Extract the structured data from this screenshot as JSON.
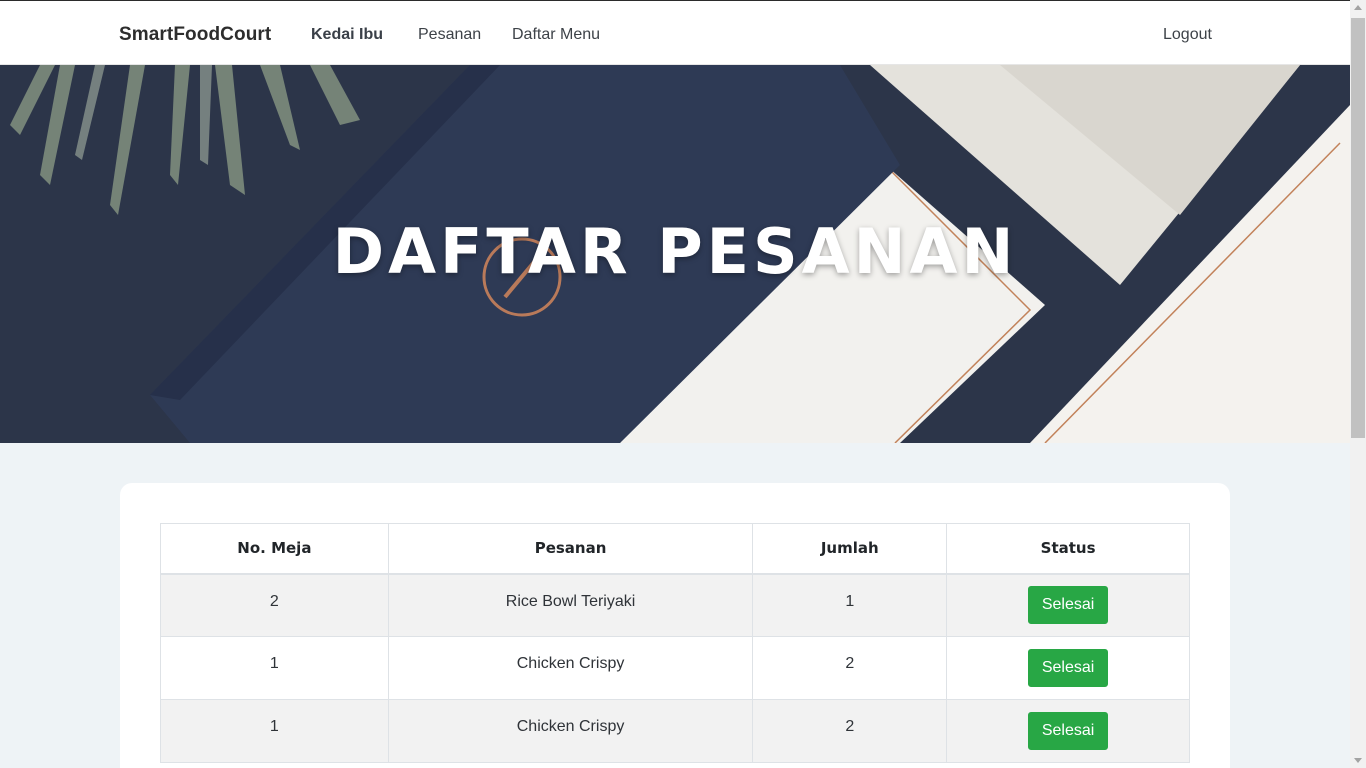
{
  "navbar": {
    "brand": "SmartFoodCourt",
    "links": [
      "Kedai Ibu",
      "Pesanan",
      "Daftar Menu"
    ],
    "logout": "Logout"
  },
  "hero": {
    "title": "DAFTAR PESANAN"
  },
  "table": {
    "headers": [
      "No. Meja",
      "Pesanan",
      "Jumlah",
      "Status"
    ],
    "rows": [
      {
        "meja": "2",
        "pesanan": "Rice Bowl Teriyaki",
        "jumlah": "1",
        "status": "Selesai"
      },
      {
        "meja": "1",
        "pesanan": "Chicken Crispy",
        "jumlah": "2",
        "status": "Selesai"
      },
      {
        "meja": "1",
        "pesanan": "Chicken Crispy",
        "jumlah": "2",
        "status": "Selesai"
      }
    ]
  },
  "colors": {
    "accent_button": "#28a745",
    "hero_background": "#2b3448",
    "page_background": "#eef3f6"
  }
}
